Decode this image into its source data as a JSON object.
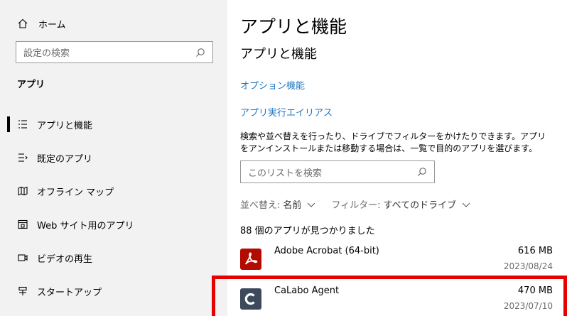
{
  "sidebar": {
    "home_label": "ホーム",
    "search_placeholder": "設定の検索",
    "section_label": "アプリ",
    "items": [
      {
        "label": "アプリと機能",
        "icon": "apps-features-icon"
      },
      {
        "label": "既定のアプリ",
        "icon": "default-apps-icon"
      },
      {
        "label": "オフライン マップ",
        "icon": "offline-maps-icon"
      },
      {
        "label": "Web サイト用のアプリ",
        "icon": "apps-for-websites-icon"
      },
      {
        "label": "ビデオの再生",
        "icon": "video-playback-icon"
      },
      {
        "label": "スタートアップ",
        "icon": "startup-icon"
      }
    ]
  },
  "main": {
    "title": "アプリと機能",
    "subtitle": "アプリと機能",
    "links": [
      "オプション機能",
      "アプリ実行エイリアス"
    ],
    "description": "検索や並べ替えを行ったり、ドライブでフィルターをかけたりできます。アプリをアンインストールまたは移動する場合は、一覧で目的のアプリを選びます。",
    "list_search_placeholder": "このリストを検索",
    "sort": {
      "label": "並べ替え:",
      "value": "名前"
    },
    "filter": {
      "label": "フィルター:",
      "value": "すべてのドライブ"
    },
    "count_text": "88 個のアプリが見つかりました",
    "apps": [
      {
        "name": "Adobe Acrobat (64-bit)",
        "size": "616 MB",
        "date": "2023/08/24",
        "icon": "adobe-acrobat-icon",
        "color": "#b30b00"
      },
      {
        "name": "CaLabo Agent",
        "size": "470 MB",
        "date": "2023/07/10",
        "icon": "calabo-agent-icon",
        "color": "#3d4a5c"
      }
    ]
  },
  "colors": {
    "accent": "#2178c4",
    "highlight": "#e60000"
  }
}
